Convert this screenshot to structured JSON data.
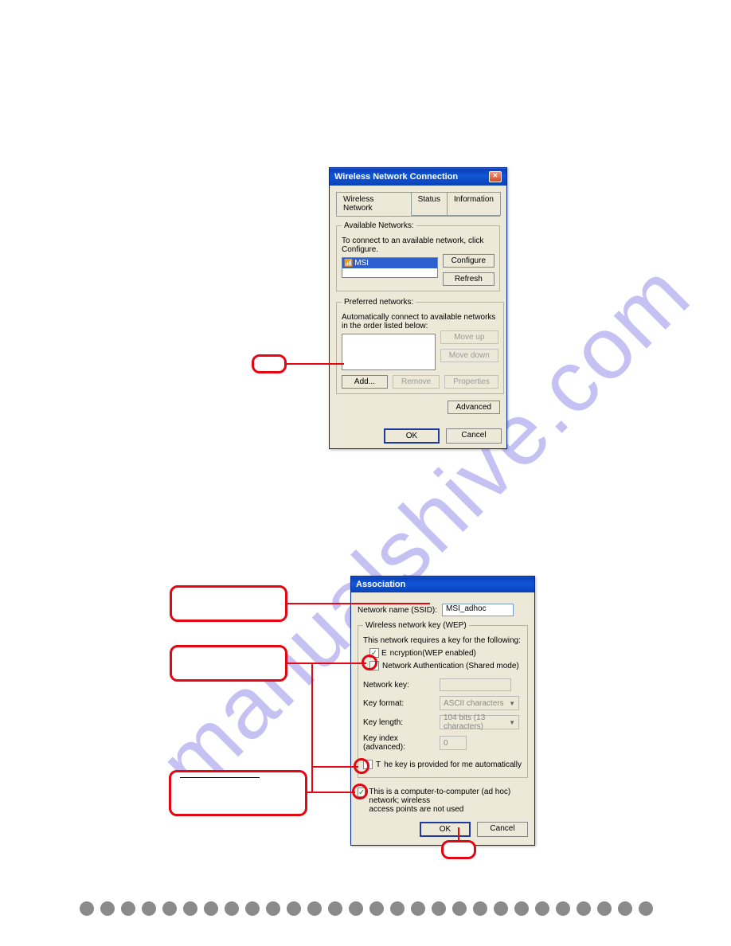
{
  "watermark": "manualshive.com",
  "window1": {
    "title": "Wireless Network Connection",
    "tabs": [
      "Wireless Network",
      "Status",
      "Information"
    ],
    "available": {
      "legend": "Available Networks:",
      "hint": "To connect to an available network, click Configure.",
      "items": [
        "MSI"
      ],
      "btn_configure": "Configure",
      "btn_refresh": "Refresh"
    },
    "preferred": {
      "legend": "Preferred networks:",
      "hint": "Automatically connect to available networks in the order listed below:",
      "btn_moveup": "Move up",
      "btn_movedown": "Move down",
      "btn_add": "Add...",
      "btn_remove": "Remove",
      "btn_properties": "Properties"
    },
    "btn_advanced": "Advanced",
    "btn_ok": "OK",
    "btn_cancel": "Cancel"
  },
  "window2": {
    "title": "Association",
    "ssid_label": "Network name (SSID):",
    "ssid_value": "MSI_adhoc",
    "wep_legend": "Wireless network key (WEP)",
    "wep_hint": "This network requires a key for the following:",
    "chk_encryption": "ncryption(WEP enabled)",
    "chk_auth": "Network Authentication (Shared mode)",
    "key_label": "Network key:",
    "format_label": "Key format:",
    "format_value": "ASCII characters",
    "length_label": "Key length:",
    "length_value": "104 bits (13 characters)",
    "index_label": "Key index (advanced):",
    "index_value": "0",
    "chk_provided": "he key is provided for me automatically",
    "chk_adhoc1": "his is a computer-to-computer (ad hoc) network; wireless",
    "chk_adhoc2": "ccess points are not used",
    "btn_ok": "OK",
    "btn_cancel": "Cancel"
  }
}
